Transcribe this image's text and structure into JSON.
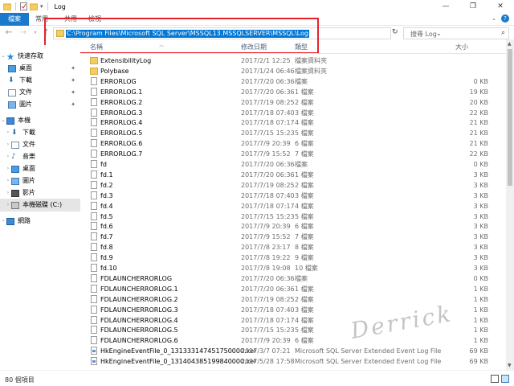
{
  "window": {
    "title": "Log",
    "controls": {
      "minimize": "—",
      "maximize": "❐",
      "close": "✕"
    }
  },
  "ribbon": {
    "tabs": [
      "檔案",
      "常用",
      "共用",
      "檢視"
    ]
  },
  "address": {
    "path": "C:\\Program Files\\Microsoft SQL Server\\MSSQL13.MSSQLSERVER\\MSSQL\\Log",
    "search_placeholder": "搜尋 Log"
  },
  "columns": {
    "name": "名稱",
    "date": "修改日期",
    "type": "類型",
    "size": "大小"
  },
  "nav": {
    "quick_access": "快速存取",
    "quick_items": [
      "桌面",
      "下載",
      "文件",
      "圖片"
    ],
    "this_pc": "本機",
    "pc_items": [
      "下載",
      "文件",
      "音樂",
      "桌面",
      "圖片",
      "影片",
      "本機磁碟 (C:)"
    ],
    "network": "網路"
  },
  "files": [
    {
      "name": "ExtensibilityLog",
      "date": "2017/2/1 12:25",
      "type": "檔案資料夾",
      "size": "",
      "kind": "folder"
    },
    {
      "name": "Polybase",
      "date": "2017/1/24 06:46",
      "type": "檔案資料夾",
      "size": "",
      "kind": "folder"
    },
    {
      "name": "ERRORLOG",
      "date": "2017/7/20 06:36",
      "type": "檔案",
      "size": "0 KB",
      "kind": "file"
    },
    {
      "name": "ERRORLOG.1",
      "date": "2017/7/20 06:36",
      "type": "1 檔案",
      "size": "19 KB",
      "kind": "file"
    },
    {
      "name": "ERRORLOG.2",
      "date": "2017/7/19 08:25",
      "type": "2 檔案",
      "size": "20 KB",
      "kind": "file"
    },
    {
      "name": "ERRORLOG.3",
      "date": "2017/7/18 07:40",
      "type": "3 檔案",
      "size": "22 KB",
      "kind": "file"
    },
    {
      "name": "ERRORLOG.4",
      "date": "2017/7/18 07:17",
      "type": "4 檔案",
      "size": "21 KB",
      "kind": "file"
    },
    {
      "name": "ERRORLOG.5",
      "date": "2017/7/15 15:23",
      "type": "5 檔案",
      "size": "21 KB",
      "kind": "file"
    },
    {
      "name": "ERRORLOG.6",
      "date": "2017/7/9 20:39",
      "type": "6 檔案",
      "size": "21 KB",
      "kind": "file"
    },
    {
      "name": "ERRORLOG.7",
      "date": "2017/7/9 15:52",
      "type": "7 檔案",
      "size": "22 KB",
      "kind": "file"
    },
    {
      "name": "fd",
      "date": "2017/7/20 06:36",
      "type": "檔案",
      "size": "0 KB",
      "kind": "file"
    },
    {
      "name": "fd.1",
      "date": "2017/7/20 06:36",
      "type": "1 檔案",
      "size": "3 KB",
      "kind": "file"
    },
    {
      "name": "fd.2",
      "date": "2017/7/19 08:25",
      "type": "2 檔案",
      "size": "3 KB",
      "kind": "file"
    },
    {
      "name": "fd.3",
      "date": "2017/7/18 07:40",
      "type": "3 檔案",
      "size": "3 KB",
      "kind": "file"
    },
    {
      "name": "fd.4",
      "date": "2017/7/18 07:17",
      "type": "4 檔案",
      "size": "3 KB",
      "kind": "file"
    },
    {
      "name": "fd.5",
      "date": "2017/7/15 15:23",
      "type": "5 檔案",
      "size": "3 KB",
      "kind": "file"
    },
    {
      "name": "fd.6",
      "date": "2017/7/9 20:39",
      "type": "6 檔案",
      "size": "3 KB",
      "kind": "file"
    },
    {
      "name": "fd.7",
      "date": "2017/7/9 15:52",
      "type": "7 檔案",
      "size": "3 KB",
      "kind": "file"
    },
    {
      "name": "fd.8",
      "date": "2017/7/8 23:17",
      "type": "8 檔案",
      "size": "3 KB",
      "kind": "file"
    },
    {
      "name": "fd.9",
      "date": "2017/7/8 19:22",
      "type": "9 檔案",
      "size": "3 KB",
      "kind": "file"
    },
    {
      "name": "fd.10",
      "date": "2017/7/8 19:08",
      "type": "10 檔案",
      "size": "3 KB",
      "kind": "file"
    },
    {
      "name": "FDLAUNCHERRORLOG",
      "date": "2017/7/20 06:36",
      "type": "檔案",
      "size": "0 KB",
      "kind": "file"
    },
    {
      "name": "FDLAUNCHERRORLOG.1",
      "date": "2017/7/20 06:36",
      "type": "1 檔案",
      "size": "1 KB",
      "kind": "file"
    },
    {
      "name": "FDLAUNCHERRORLOG.2",
      "date": "2017/7/19 08:25",
      "type": "2 檔案",
      "size": "1 KB",
      "kind": "file"
    },
    {
      "name": "FDLAUNCHERRORLOG.3",
      "date": "2017/7/18 07:40",
      "type": "3 檔案",
      "size": "1 KB",
      "kind": "file"
    },
    {
      "name": "FDLAUNCHERRORLOG.4",
      "date": "2017/7/18 07:17",
      "type": "4 檔案",
      "size": "1 KB",
      "kind": "file"
    },
    {
      "name": "FDLAUNCHERRORLOG.5",
      "date": "2017/7/15 15:23",
      "type": "5 檔案",
      "size": "1 KB",
      "kind": "file"
    },
    {
      "name": "FDLAUNCHERRORLOG.6",
      "date": "2017/7/9 20:39",
      "type": "6 檔案",
      "size": "1 KB",
      "kind": "file"
    },
    {
      "name": "HkEngineEventFile_0_131333147451750000.xel",
      "date": "2017/3/7 07:21",
      "type": "Microsoft SQL Server Extended Event Log File",
      "size": "69 KB",
      "kind": "xel"
    },
    {
      "name": "HkEngineEventFile_0_131404385199840000.xel",
      "date": "2017/5/28 17:58",
      "type": "Microsoft SQL Server Extended Event Log File",
      "size": "69 KB",
      "kind": "xel"
    }
  ],
  "status": {
    "item_count": "80 個項目"
  },
  "watermark": "Derrick",
  "colors": {
    "accent": "#1979ca",
    "selection": "#0078d7",
    "highlight_box": "#e8202a",
    "folder": "#f4cd60"
  }
}
